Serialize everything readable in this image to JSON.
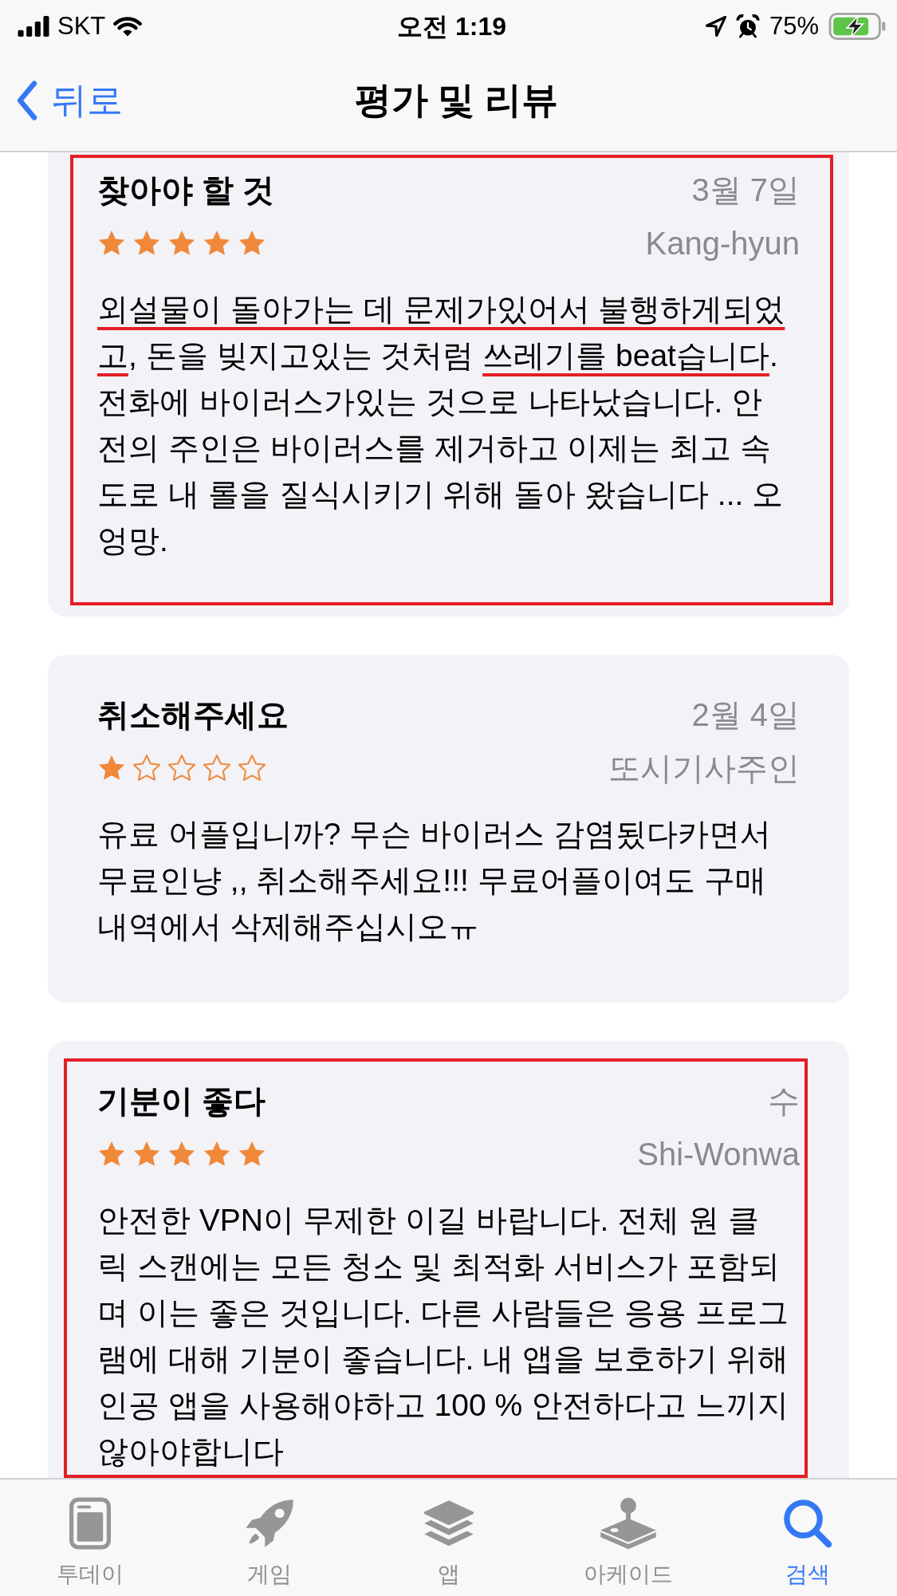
{
  "status_bar": {
    "carrier": "SKT",
    "time": "오전 1:19",
    "battery": "75%"
  },
  "nav_bar": {
    "back": "뒤로",
    "title": "평가 및 리뷰"
  },
  "reviews": [
    {
      "title": "찾아야 할 것",
      "date": "3월 7일",
      "author": "Kang-hyun",
      "stars": 5,
      "boxed": true,
      "body": [
        {
          "text": "외설물이 돌아가는 데 문제가있어서 불행하게되었고",
          "underlined": true
        },
        {
          "text": ", 돈을 빚지고있는 것처럼 ",
          "underlined": false
        },
        {
          "text": "쓰레기를 beat습니다",
          "underlined": true
        },
        {
          "text": ". 전화에 바이러스가있는 것으로 나타났습니다. 안전의 주인은 바이러스를 제거하고 이제는 최고 속도로 내 롤을 질식시키기 위해 돌아 왔습니다 ... 오 엉망.",
          "underlined": false
        }
      ]
    },
    {
      "title": "취소해주세요",
      "date": "2월 4일",
      "author": "또시기사주인",
      "stars": 1,
      "boxed": false,
      "body": [
        {
          "text": "유료 어플입니까? 무슨 바이러스 감염됬다카면서 무료인냥 ,, 취소해주세요!!! 무료어플이여도 구매내역에서 삭제해주십시오ㅠ",
          "underlined": false
        }
      ]
    },
    {
      "title": "기분이 좋다",
      "date": "수",
      "author": "Shi-Wonwa",
      "stars": 5,
      "boxed": true,
      "body": [
        {
          "text": "안전한 VPN이 무제한 이길 바랍니다. 전체 원 클릭 스캔에는 모든 청소 및 최적화 서비스가 포함되며 이는 좋은 것입니다. 다른 사람들은 응용 프로그램에 대해 기분이 좋습니다. 내 앱을 보호하기 위해 인공 앱을 사용해야하고 100 % 안전하다고 느끼지 않아야합니다",
          "underlined": false
        }
      ]
    }
  ],
  "tab_bar": [
    {
      "label": "투데이",
      "selected": false
    },
    {
      "label": "게임",
      "selected": false
    },
    {
      "label": "앱",
      "selected": false
    },
    {
      "label": "아케이드",
      "selected": false
    },
    {
      "label": "검색",
      "selected": true
    }
  ]
}
